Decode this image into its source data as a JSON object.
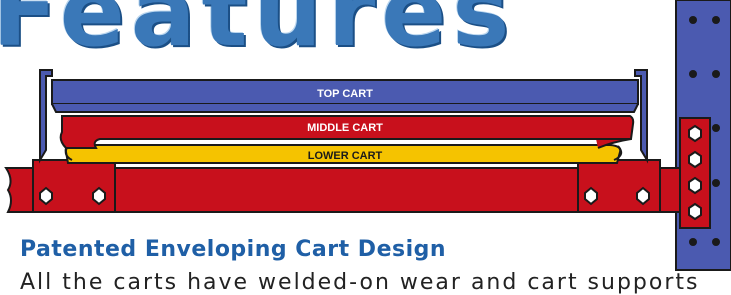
{
  "header": {
    "word": "Features"
  },
  "diagram": {
    "top_cart_label": "TOP CART",
    "middle_cart_label": "MIDDLE CART",
    "lower_cart_label": "LOWER CART"
  },
  "section": {
    "heading": "Patented Enveloping Cart Design",
    "body_text": "All the carts have welded-on wear and cart supports"
  },
  "colors": {
    "top_cart": "#4b5ab0",
    "middle_cart": "#c8101c",
    "lower_cart": "#f5c300",
    "upright": "#4b5ab0",
    "heading": "#1f5fa6"
  }
}
